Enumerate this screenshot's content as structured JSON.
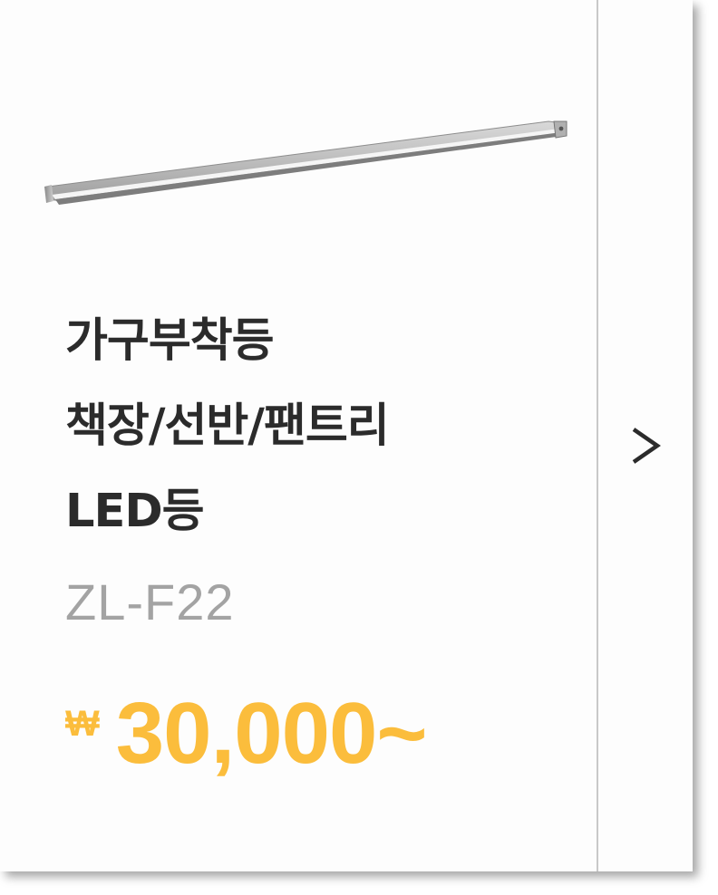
{
  "product": {
    "title_lines": [
      "가구부착등",
      "책장/선반/팬트리",
      "LED등"
    ],
    "model": "ZL-F22",
    "currency_symbol": "₩",
    "price": "30,000~"
  },
  "navigation": {
    "next_icon": "chevron-right-icon"
  },
  "colors": {
    "title": "#2b2b2b",
    "model": "#a3a3a3",
    "price": "#fbbd3c",
    "divider": "#c9c9c9"
  }
}
